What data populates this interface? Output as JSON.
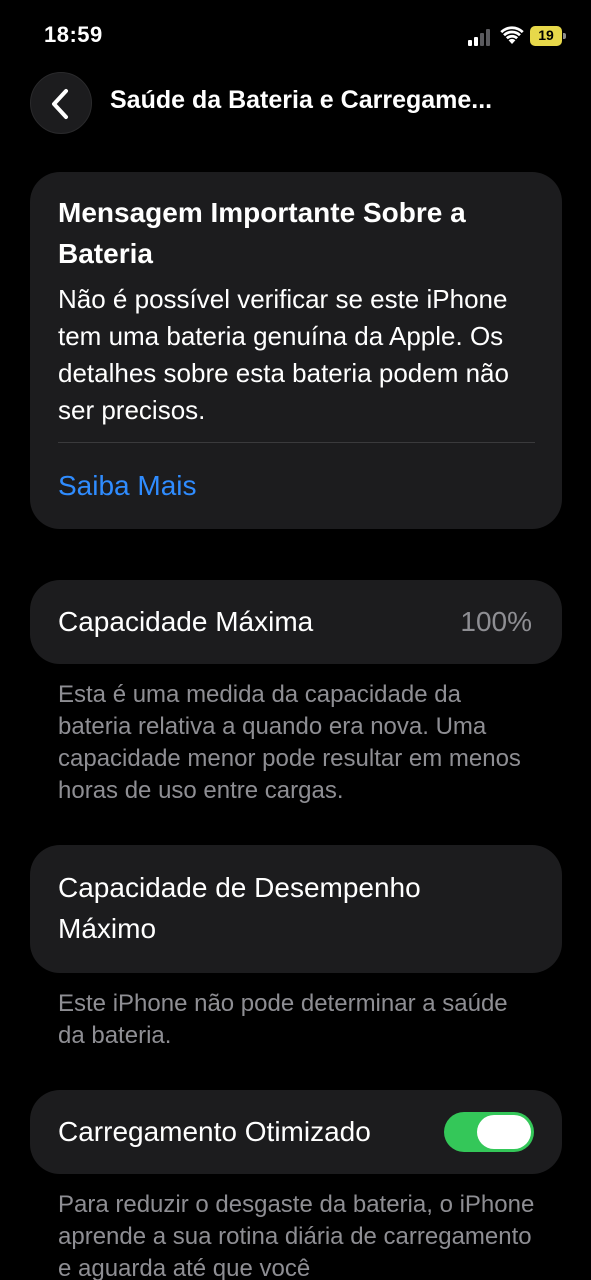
{
  "status_bar": {
    "time": "18:59",
    "battery_level": "19",
    "icons": [
      "cellular-signal-icon",
      "wifi-icon",
      "battery-icon"
    ]
  },
  "nav": {
    "back_icon": "chevron-left-icon",
    "title": "Saúde da Bateria e Carregame..."
  },
  "message_card": {
    "title": "Mensagem Importante Sobre a Bateria",
    "body": "Não é possível verificar se este iPhone tem uma bateria genuína da Apple. Os detalhes sobre esta bateria podem não ser precisos.",
    "link": "Saiba Mais"
  },
  "max_capacity": {
    "label": "Capacidade Máxima",
    "value": "100%",
    "footnote": "Esta é uma medida da capacidade da bateria relativa a quando era nova. Uma capacidade menor pode resultar em menos horas de uso entre cargas."
  },
  "peak_performance": {
    "label": "Capacidade de Desempenho Máximo",
    "footnote": "Este iPhone não pode determinar a saúde da bateria."
  },
  "optimized_charging": {
    "label": "Carregamento Otimizado",
    "enabled": true,
    "footnote": "Para reduzir o desgaste da bateria, o iPhone aprende a sua rotina diária de carregamento e aguarda até que você"
  },
  "colors": {
    "background": "#000000",
    "card": "#1c1c1e",
    "link": "#2f8cff",
    "secondary_text": "#8e8e93",
    "toggle_on": "#34c759",
    "battery_low": "#e7d84a"
  }
}
